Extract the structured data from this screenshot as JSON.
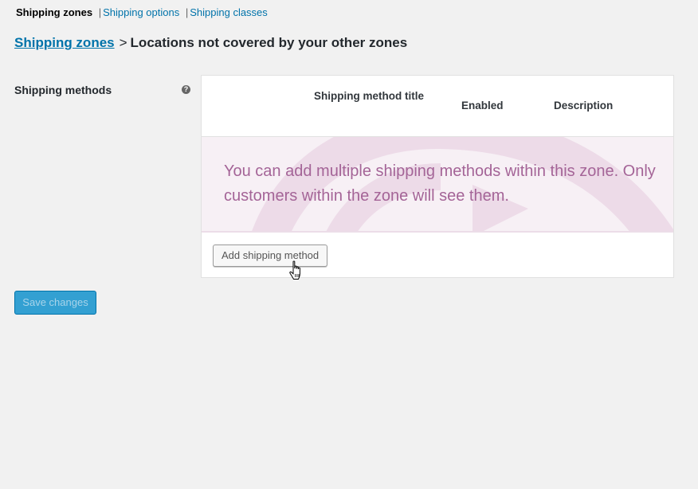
{
  "subnav": {
    "current": "Shipping zones",
    "links": [
      "Shipping options",
      "Shipping classes"
    ],
    "separator": "|"
  },
  "heading": {
    "link": "Shipping zones",
    "arrow": ">",
    "title": "Locations not covered by your other zones"
  },
  "form": {
    "label": "Shipping methods",
    "help_icon": "question-icon",
    "help_glyph": "?"
  },
  "table": {
    "columns": [
      "Shipping method title",
      "Enabled",
      "Description"
    ],
    "blank_state_message": "You can add multiple shipping methods within this zone. Only customers within the zone will see them.",
    "add_button": "Add shipping method"
  },
  "save_button": "Save changes",
  "colors": {
    "link": "#0073aa",
    "blank_state_text": "#a46497",
    "blank_state_bg": "#f7f0f5",
    "primary_button": "#33a0d2"
  }
}
